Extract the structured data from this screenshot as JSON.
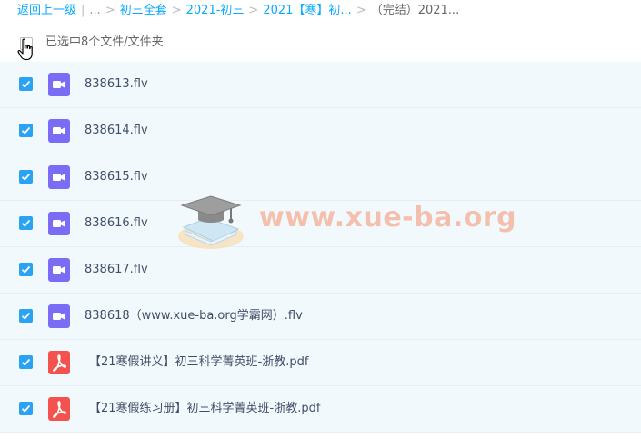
{
  "breadcrumb": {
    "back": "返回上一级",
    "ellipsis": "...",
    "items": [
      "初三全套",
      "2021-初三",
      "2021【寒】初..."
    ],
    "current": "（完结）2021..."
  },
  "selection": {
    "count_text": "已选中8个文件/文件夹"
  },
  "files": [
    {
      "name": "838613.flv",
      "type": "video"
    },
    {
      "name": "838614.flv",
      "type": "video"
    },
    {
      "name": "838615.flv",
      "type": "video"
    },
    {
      "name": "838616.flv",
      "type": "video"
    },
    {
      "name": "838617.flv",
      "type": "video"
    },
    {
      "name": "838618（www.xue-ba.org学霸网）.flv",
      "type": "video"
    },
    {
      "name": "【21寒假讲义】初三科学菁英班-浙教.pdf",
      "type": "pdf"
    },
    {
      "name": "【21寒假练习册】初三科学菁英班-浙教.pdf",
      "type": "pdf"
    }
  ],
  "watermark": {
    "text": "www.xue-ba.org"
  },
  "colors": {
    "link": "#09AAFF",
    "checkbox": "#2aa3f5",
    "video_icon": "#7b6cf6",
    "pdf_icon": "#f4524f",
    "row_bg": "#f2f9fd"
  }
}
